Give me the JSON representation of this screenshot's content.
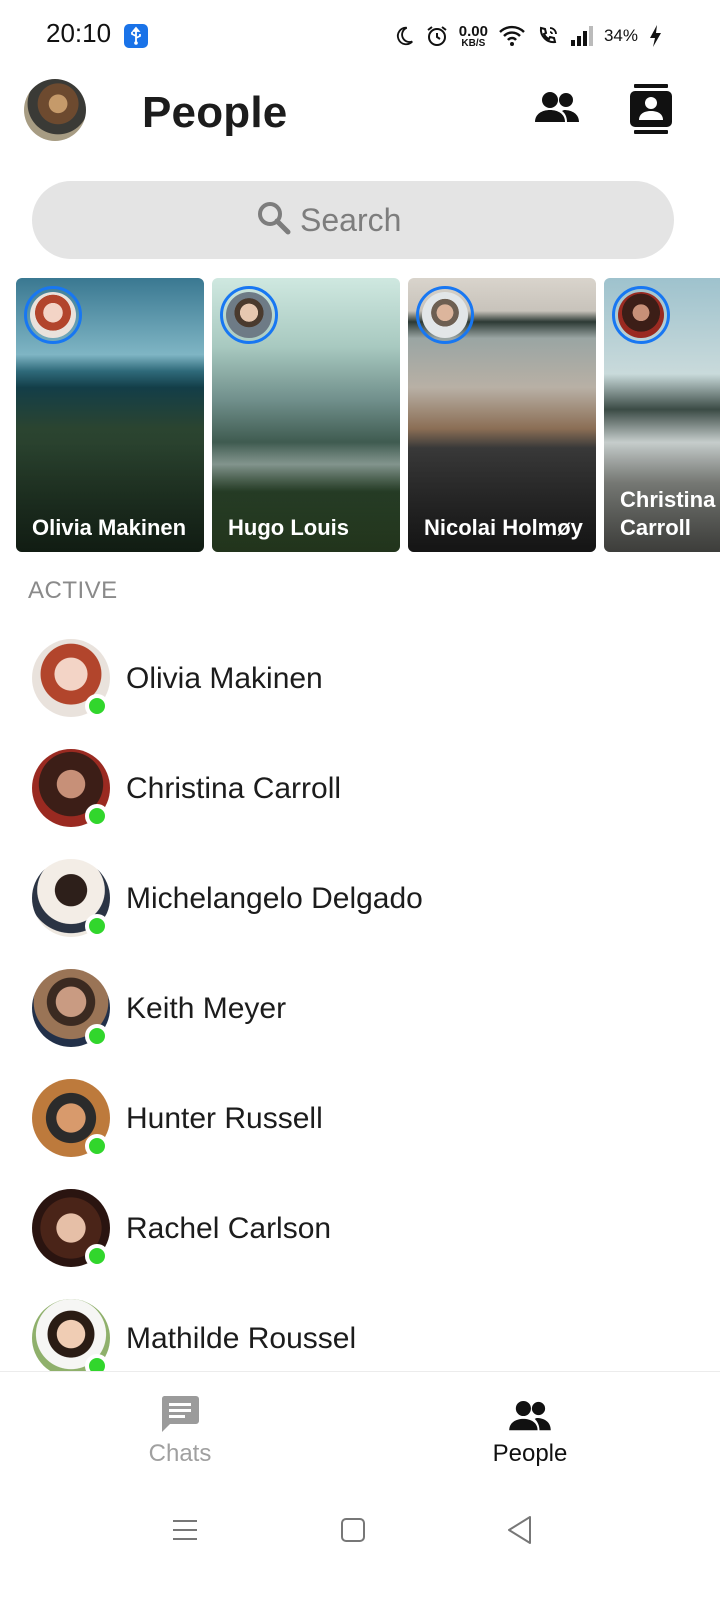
{
  "status_bar": {
    "time": "20:10",
    "net_speed_value": "0.00",
    "net_speed_unit": "KB/S",
    "battery": "34%",
    "icons": [
      "usb-debug-icon",
      "moon-icon",
      "alarm-icon",
      "wifi-icon",
      "wifi-call-icon",
      "signal-icon",
      "charging-icon"
    ]
  },
  "header": {
    "title": "People",
    "actions": [
      "people-icon",
      "contacts-icon"
    ]
  },
  "search": {
    "placeholder": "Search"
  },
  "stories": [
    {
      "name": "Olivia Makinen"
    },
    {
      "name": "Hugo Louis"
    },
    {
      "name": "Nicolai Holmøy"
    },
    {
      "name": "Christina Carroll"
    }
  ],
  "active": {
    "label": "ACTIVE",
    "people": [
      {
        "name": "Olivia Makinen"
      },
      {
        "name": "Christina Carroll"
      },
      {
        "name": "Michelangelo Delgado"
      },
      {
        "name": "Keith Meyer"
      },
      {
        "name": "Hunter Russell"
      },
      {
        "name": "Rachel Carlson"
      },
      {
        "name": "Mathilde Roussel"
      }
    ]
  },
  "bottom_nav": {
    "tabs": [
      {
        "label": "Chats",
        "icon": "chat-bubble-icon",
        "selected": false
      },
      {
        "label": "People",
        "icon": "people-icon",
        "selected": true
      }
    ]
  },
  "colors": {
    "accent": "#1877f2",
    "online": "#31d62c",
    "search_bg": "#e4e4e4",
    "inactive_tab": "#a0a0a0"
  }
}
